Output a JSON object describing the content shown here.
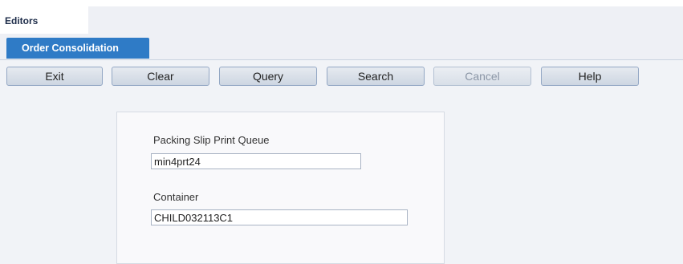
{
  "header": {
    "editors_tab": "Editors"
  },
  "subtab": {
    "label": "Order Consolidation"
  },
  "toolbar": {
    "buttons": [
      {
        "label": "Exit"
      },
      {
        "label": "Clear"
      },
      {
        "label": "Query"
      },
      {
        "label": "Search"
      },
      {
        "label": "Cancel",
        "disabled": true
      },
      {
        "label": "Help"
      }
    ]
  },
  "form": {
    "packing_slip_label": "Packing Slip Print Queue",
    "packing_slip_value": "min4prt24",
    "container_label": "Container",
    "container_value": "CHILD032113C1"
  },
  "colors": {
    "accent_tab": "#2f7bc6",
    "background": "#f1f3f7"
  }
}
